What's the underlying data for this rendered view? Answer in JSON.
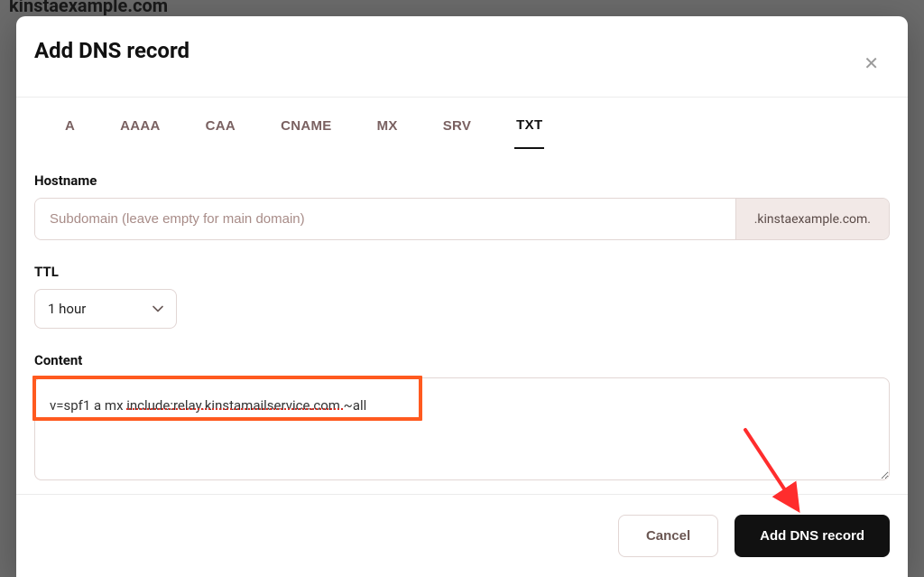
{
  "background": {
    "domain_header": "kinstaexample.com"
  },
  "modal": {
    "title": "Add DNS record",
    "close_aria": "Close",
    "tabs": [
      {
        "id": "a",
        "label": "A",
        "active": false
      },
      {
        "id": "aaaa",
        "label": "AAAA",
        "active": false
      },
      {
        "id": "caa",
        "label": "CAA",
        "active": false
      },
      {
        "id": "cname",
        "label": "CNAME",
        "active": false
      },
      {
        "id": "mx",
        "label": "MX",
        "active": false
      },
      {
        "id": "srv",
        "label": "SRV",
        "active": false
      },
      {
        "id": "txt",
        "label": "TXT",
        "active": true
      }
    ],
    "hostname": {
      "label": "Hostname",
      "placeholder": "Subdomain (leave empty for main domain)",
      "value": "",
      "suffix": ".kinstaexample.com."
    },
    "ttl": {
      "label": "TTL",
      "value": "1 hour"
    },
    "content": {
      "label": "Content",
      "value": "v=spf1 a mx include:relay.kinstamailservice.com ~all"
    },
    "footer": {
      "cancel": "Cancel",
      "submit": "Add DNS record"
    }
  },
  "annotations": {
    "highlight_color": "#ff5a1f",
    "arrow_color": "#ff2d2d"
  }
}
